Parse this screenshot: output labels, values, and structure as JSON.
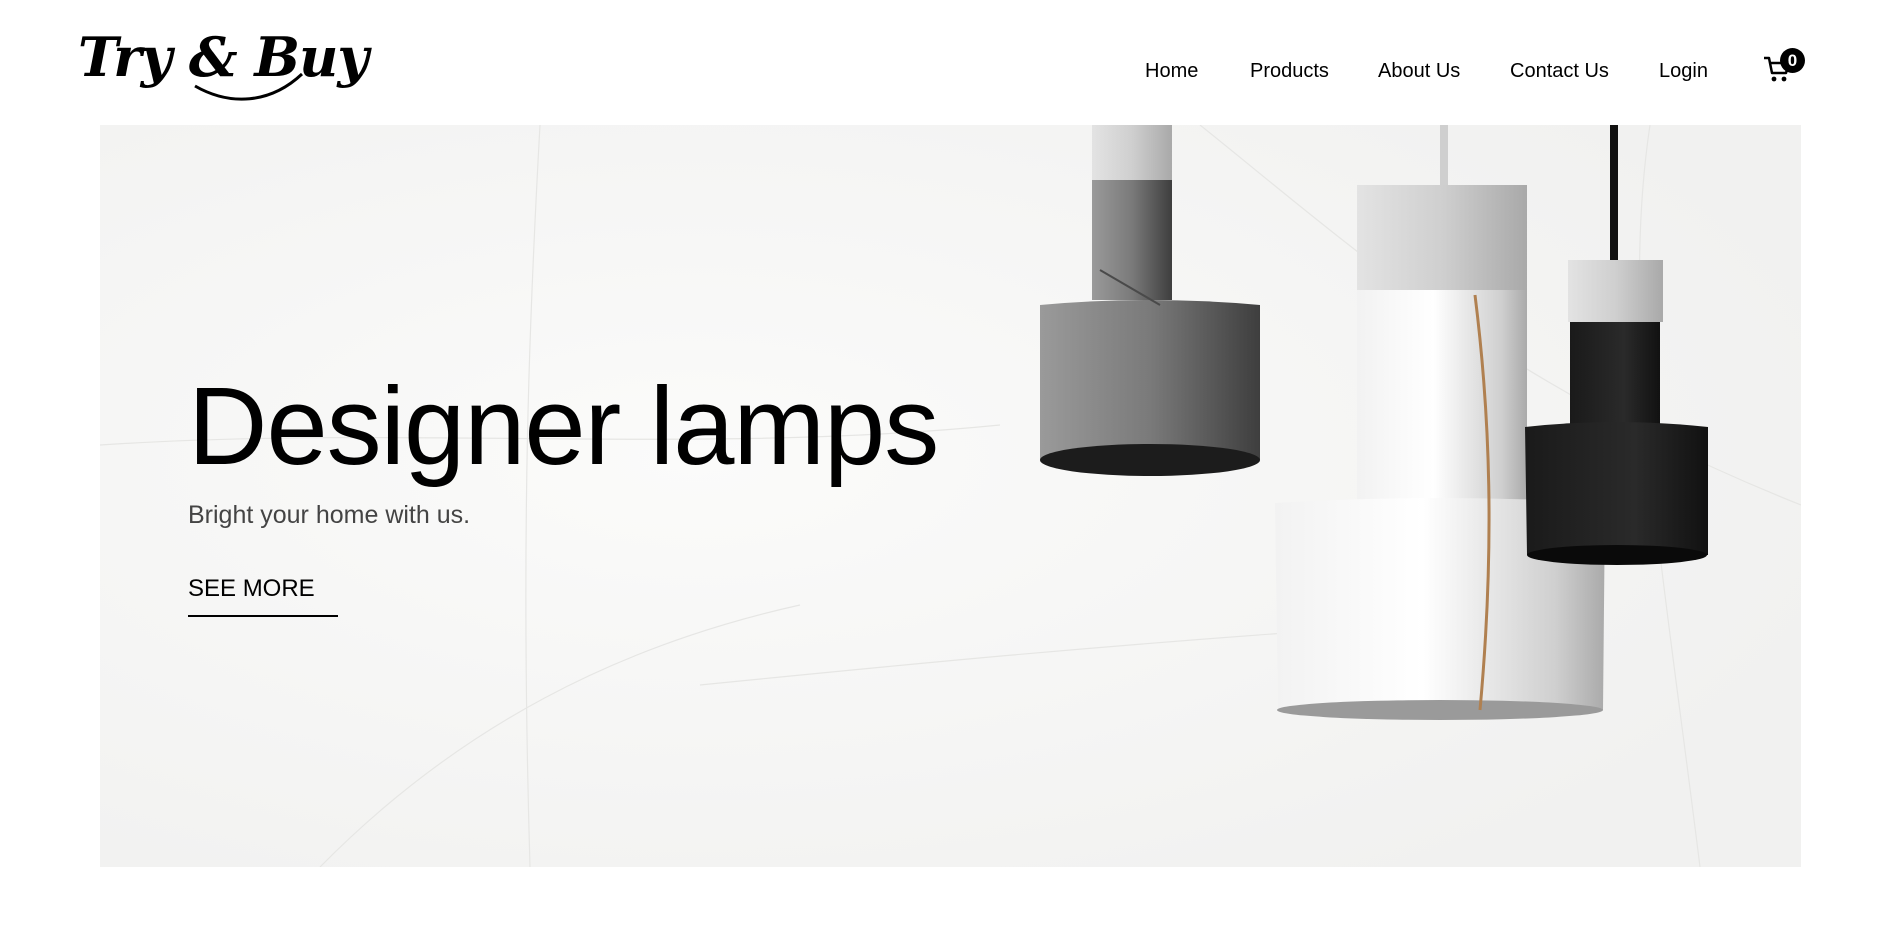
{
  "header": {
    "logo_text": "Try & Buy",
    "nav": [
      {
        "label": "Home"
      },
      {
        "label": "Products"
      },
      {
        "label": "About Us"
      },
      {
        "label": "Contact Us"
      },
      {
        "label": "Login"
      }
    ],
    "cart": {
      "icon": "cart-icon",
      "count": "0"
    }
  },
  "hero": {
    "title": "Designer lamps",
    "subtitle": "Bright your home with us.",
    "cta_label": "SEE MORE",
    "image": "pendant-lamps-illustration"
  },
  "colors": {
    "background": "#ffffff",
    "hero_background": "#f6f6f5",
    "text": "#000000",
    "subtitle_text": "#444444"
  }
}
